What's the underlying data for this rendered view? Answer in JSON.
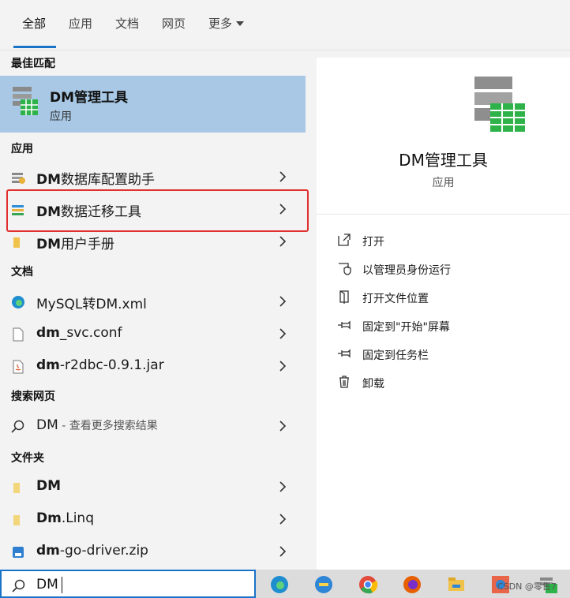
{
  "tabs": [
    {
      "label": "全部",
      "active": true
    },
    {
      "label": "应用"
    },
    {
      "label": "文档"
    },
    {
      "label": "网页"
    },
    {
      "label": "更多"
    }
  ],
  "sections": {
    "best_match": "最佳匹配",
    "apps": "应用",
    "docs": "文档",
    "web": "搜索网页",
    "folders": "文件夹"
  },
  "best_match": {
    "title": "DM管理工具",
    "subtitle": "应用"
  },
  "apps": [
    {
      "bold": "DM",
      "rest": "数据库配置助手"
    },
    {
      "bold": "DM",
      "rest": "数据迁移工具"
    },
    {
      "bold": "DM",
      "rest": "用户手册"
    }
  ],
  "docs": [
    {
      "bold": "",
      "rest": "MySQL转DM.xml"
    },
    {
      "bold": "dm",
      "rest": "_svc.conf"
    },
    {
      "bold": "dm",
      "rest": "-r2dbc-0.9.1.jar"
    }
  ],
  "web": {
    "query": "DM",
    "hint": " - 查看更多搜索结果"
  },
  "folders": [
    {
      "bold": "DM",
      "rest": ""
    },
    {
      "bold": "Dm",
      "rest": ".Linq"
    },
    {
      "bold": "dm",
      "rest": "-go-driver.zip"
    }
  ],
  "detail": {
    "title": "DM管理工具",
    "subtitle": "应用",
    "actions": [
      "打开",
      "以管理员身份运行",
      "打开文件位置",
      "固定到\"开始\"屏幕",
      "固定到任务栏",
      "卸载"
    ]
  },
  "search": {
    "value": "DM"
  },
  "watermark": "CSDN @零售7",
  "colors": {
    "accent": "#1a73c8",
    "selection": "#a8c8e6",
    "highlight": "#e0302f"
  }
}
